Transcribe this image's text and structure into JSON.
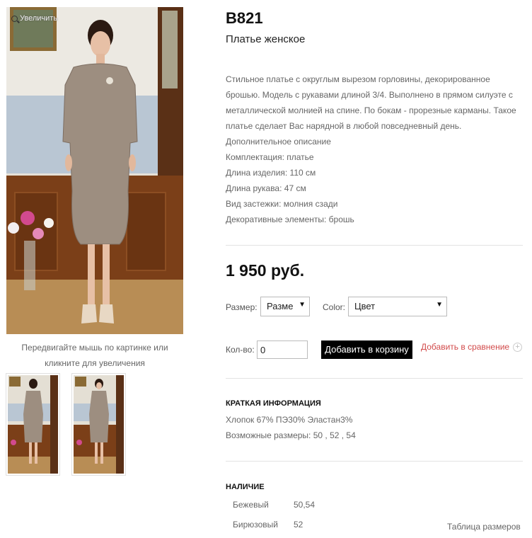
{
  "gallery": {
    "zoom_label": "Увеличить",
    "hint": "Передвигайте мышь по картинке или кликните для увеличения",
    "thumbnails": [
      "thumbnail-back",
      "thumbnail-front"
    ]
  },
  "product": {
    "sku": "B821",
    "subtitle": "Платье женское",
    "description": [
      "Стильное платье с округлым вырезом горловины, декорированное брошью. Модель с рукавами длиной 3/4. Выполнено в прямом силуэте с металлической молнией на спине. По бокам - прорезные карманы. Такое платье сделает Вас нарядной в любой повседневный день.",
      "Дополнительное описание",
      "Комплектация: платье",
      "Длина изделия: 110 см",
      "Длина рукава: 47 см",
      "Вид застежки: молния сзади",
      "Декоративные элементы: брошь"
    ],
    "price": "1 950 руб."
  },
  "options": {
    "size_label": "Размер:",
    "size_value": "Разме",
    "color_label": "Color:",
    "color_value": "Цвет",
    "arrow_glyph": "▼"
  },
  "cart": {
    "qty_label": "Кол-во:",
    "qty_value": "0",
    "add_button": "Добавить в корзину",
    "compare_link": "Добавить в сравнение",
    "compare_icon": "+"
  },
  "brief": {
    "title": "КРАТКАЯ ИНФОРМАЦИЯ",
    "composition": "Хлопок 67% ПЭ30% Эластан3%",
    "sizes": "Возможные размеры: 50 , 52 , 54"
  },
  "availability": {
    "title": "НАЛИЧИЕ",
    "rows": [
      {
        "color": "Бежевый",
        "sizes": "50,54"
      },
      {
        "color": "Бирюзовый",
        "sizes": "52"
      }
    ],
    "size_table_link": "Таблица размеров"
  },
  "colors": {
    "accent_link": "#d24b4b",
    "button_bg": "#000000",
    "text_muted": "#666666"
  }
}
